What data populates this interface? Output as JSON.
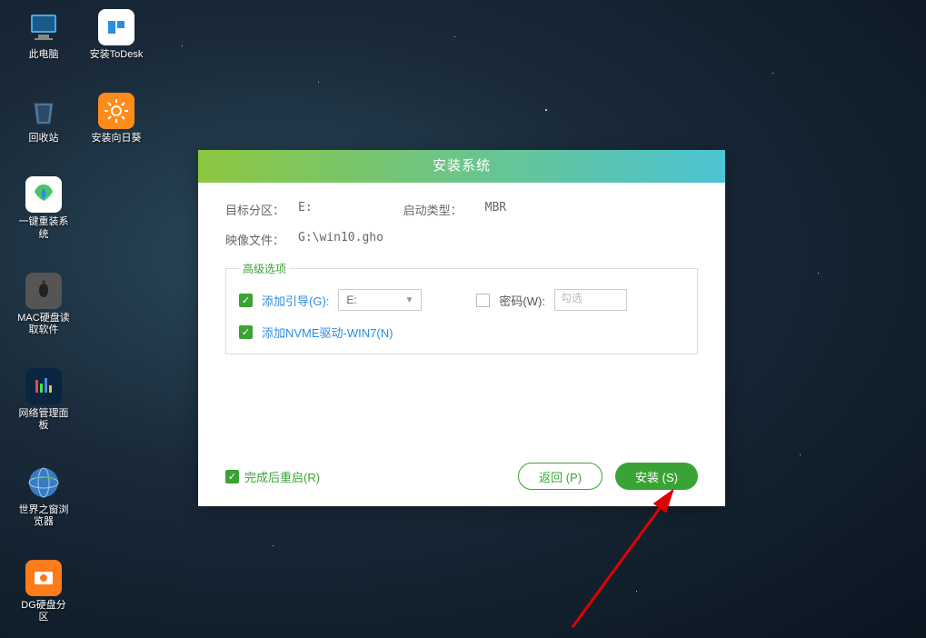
{
  "desktop": {
    "icons": [
      {
        "label": "此电脑"
      },
      {
        "label": "安装ToDesk"
      },
      {
        "label": "回收站"
      },
      {
        "label": "安装向日葵"
      },
      {
        "label": "一键重装系统"
      },
      {
        "label": "MAC硬盘读取软件"
      },
      {
        "label": "网络管理面板"
      },
      {
        "label": "世界之窗浏览器"
      },
      {
        "label": "DG硬盘分区"
      }
    ]
  },
  "dialog": {
    "title": "安装系统",
    "partition_label": "目标分区：",
    "partition_value": "E:",
    "boot_type_label": "启动类型：",
    "boot_type_value": "MBR",
    "image_label": "映像文件：",
    "image_value": "G:\\win10.gho",
    "advanced": {
      "legend": "高级选项",
      "add_boot_label": "添加引导(G):",
      "add_boot_value": "E:",
      "password_label": "密码(W):",
      "password_placeholder": "勾选",
      "nvme_label": "添加NVME驱动-WIN7(N)"
    },
    "restart_label": "完成后重启(R)",
    "back_label": "返回 (P)",
    "install_label": "安装 (S)"
  }
}
